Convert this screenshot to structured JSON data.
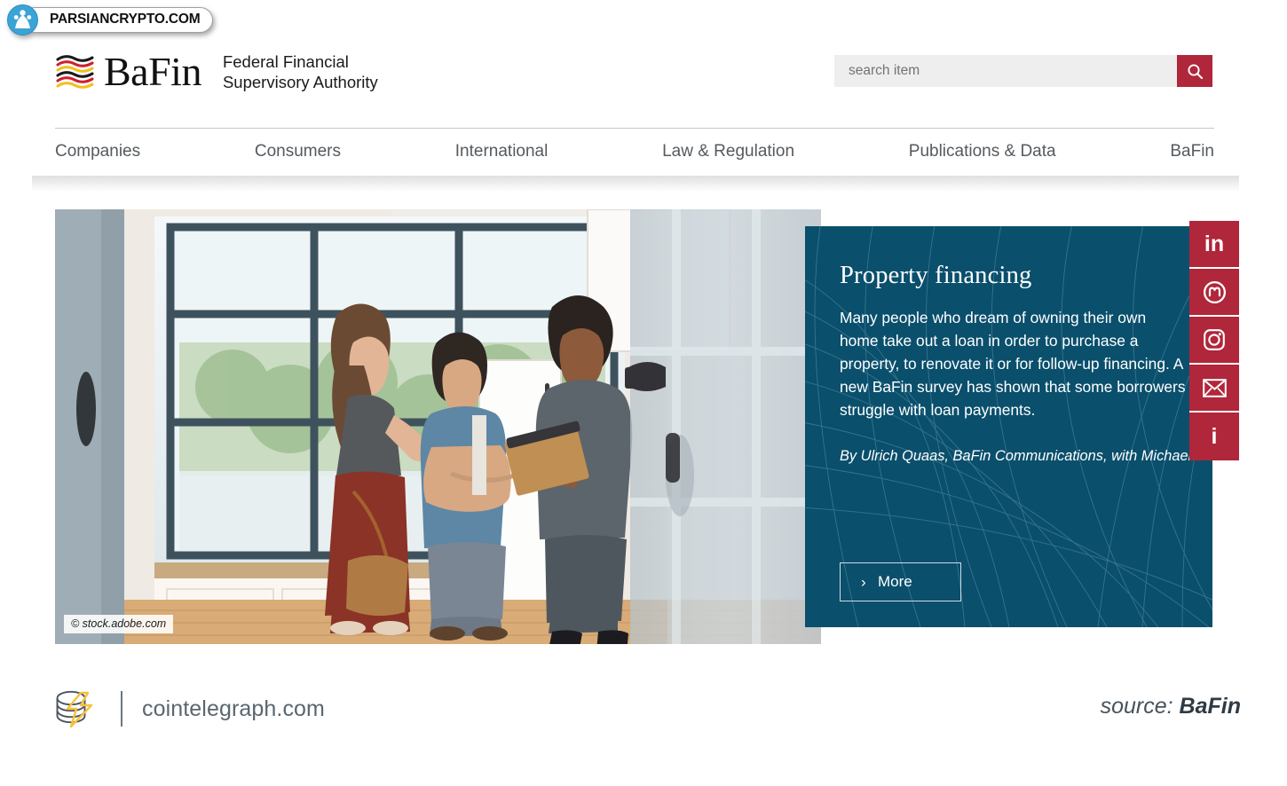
{
  "watermark": {
    "text": "PARSIANCRYPTO.COM",
    "icon": "parsiancrypto-logo-icon"
  },
  "header": {
    "logo_word": "BaFin",
    "logo_mark": "bafin-wave-icon",
    "org_line1": "Federal Financial",
    "org_line2": "Supervisory Authority",
    "search": {
      "placeholder": "search item",
      "value": "",
      "button_icon": "search-icon",
      "button_color": "#b0263a"
    }
  },
  "nav": {
    "items": [
      {
        "label": "Companies"
      },
      {
        "label": "Consumers"
      },
      {
        "label": "International"
      },
      {
        "label": "Law & Regulation"
      },
      {
        "label": "Publications & Data"
      },
      {
        "label": "BaFin"
      }
    ]
  },
  "hero": {
    "photo": {
      "alt": "Three people talking in a modern kitchen during a property viewing",
      "credit": "© stock.adobe.com"
    },
    "panel": {
      "background_color": "#0a4f6c",
      "title": "Property financing",
      "body": "Many people who dream of owning their own home take out a loan in order to purchase a property, to renovate it or for follow-up financing. A new BaFin survey has shown that some borrowers struggle with loan payments.",
      "byline": "By Ulrich Quaas, BaFin Communications, with Michael Hoi and Felix Scherger, BaFin Consumer Protection",
      "more_label": "More",
      "more_chevron": "›"
    },
    "social": {
      "color": "#b0263a",
      "items": [
        {
          "name": "linkedin-icon",
          "label": "in"
        },
        {
          "name": "mastodon-icon",
          "label": "m"
        },
        {
          "name": "instagram-icon",
          "label": ""
        },
        {
          "name": "email-icon",
          "label": ""
        },
        {
          "name": "info-icon",
          "label": "i"
        }
      ]
    }
  },
  "footer": {
    "logo_icon": "cointelegraph-coin-bolt-icon",
    "site": "cointelegraph.com",
    "source_prefix": "source: ",
    "source_name": "BaFin"
  }
}
